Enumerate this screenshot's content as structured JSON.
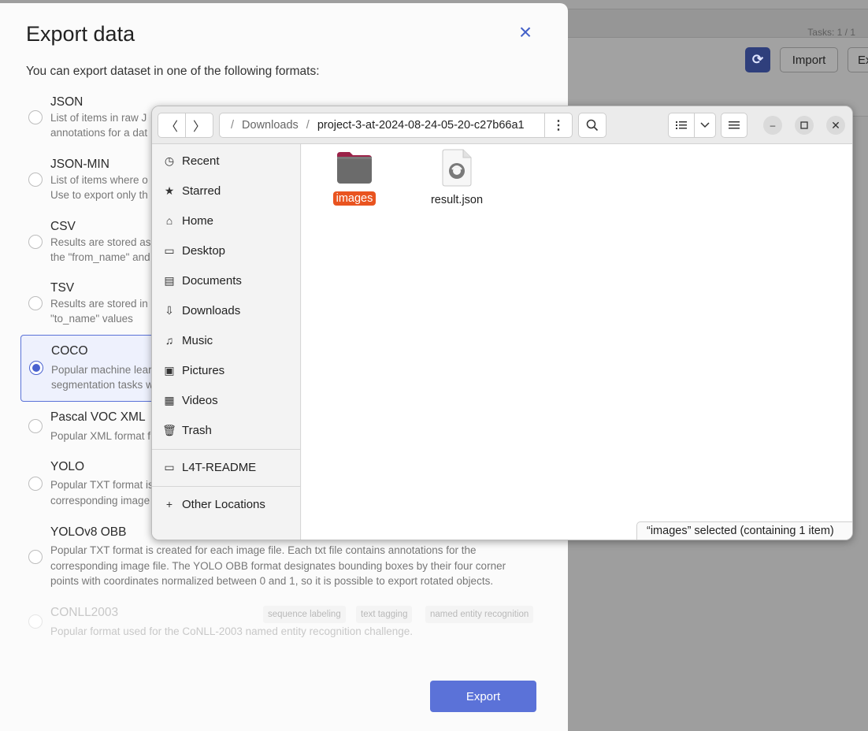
{
  "background": {
    "tasks_label": "Tasks: 1 / 1",
    "import_label": "Import",
    "export_label_partial": "Ex",
    "refresh_icon": "refresh-icon"
  },
  "modal": {
    "title": "Export data",
    "subtitle": "You can export dataset in one of the following formats:",
    "export_button": "Export",
    "selected_format": "COCO",
    "formats": [
      {
        "name": "JSON",
        "desc1": "List of items in raw J",
        "desc2": "annotations for a dat"
      },
      {
        "name": "JSON-MIN",
        "desc1": "List of items where o",
        "desc2": "Use to export only th"
      },
      {
        "name": "CSV",
        "desc1": "Results are stored as",
        "desc2": "the \"from_name\" and"
      },
      {
        "name": "TSV",
        "desc1": "Results are stored in",
        "desc2": "\"to_name\" values"
      },
      {
        "name": "COCO",
        "desc1": "Popular machine lear",
        "desc2": "segmentation tasks w"
      },
      {
        "name": "Pascal VOC XML",
        "desc1": "Popular XML format f"
      },
      {
        "name": "YOLO",
        "desc1": "Popular TXT format is",
        "desc2": "corresponding image"
      },
      {
        "name": "YOLOv8 OBB",
        "desc1": "Popular TXT format is created for each image file. Each txt file contains annotations for the",
        "desc2": "corresponding image file. The YOLO OBB format designates bounding boxes by their four corner",
        "desc3": "points with coordinates normalized between 0 and 1, so it is possible to export rotated objects."
      },
      {
        "name": "CONLL2003",
        "desc1": "Popular format used for the CoNLL-2003 named entity recognition challenge.",
        "tags": [
          "sequence labeling",
          "text tagging",
          "named entity recognition"
        ]
      }
    ]
  },
  "file_chooser": {
    "path": {
      "parent": "Downloads",
      "current": "project-3-at-2024-08-24-05-20-c27b66a1"
    },
    "sidebar": [
      {
        "label": "Recent",
        "icon": "clock-icon"
      },
      {
        "label": "Starred",
        "icon": "star-icon"
      },
      {
        "label": "Home",
        "icon": "home-icon"
      },
      {
        "label": "Desktop",
        "icon": "desktop-icon"
      },
      {
        "label": "Documents",
        "icon": "document-icon"
      },
      {
        "label": "Downloads",
        "icon": "download-icon"
      },
      {
        "label": "Music",
        "icon": "music-icon"
      },
      {
        "label": "Pictures",
        "icon": "picture-icon"
      },
      {
        "label": "Videos",
        "icon": "video-icon"
      },
      {
        "label": "Trash",
        "icon": "trash-icon"
      }
    ],
    "devices": [
      {
        "label": "L4T-README",
        "icon": "drive-icon"
      }
    ],
    "other_locations": "Other Locations",
    "files": [
      {
        "name": "images",
        "type": "folder",
        "selected": true
      },
      {
        "name": "result.json",
        "type": "json"
      }
    ],
    "status": "“images” selected  (containing 1 item)"
  }
}
